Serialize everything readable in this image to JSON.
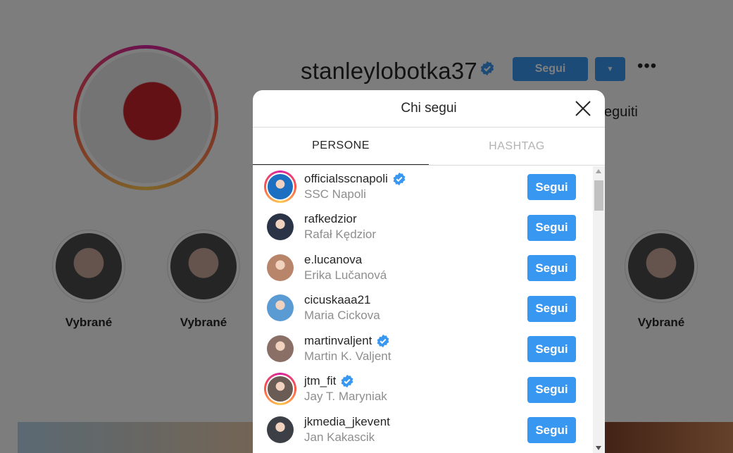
{
  "profile": {
    "username": "stanleylobotka37",
    "follow_label": "Segui",
    "more_label": "•••",
    "seguiti_label": "eguiti"
  },
  "highlights": [
    {
      "label": "Vybrané"
    },
    {
      "label": "Vybrané"
    },
    {
      "label": "Vybrané"
    }
  ],
  "modal": {
    "title": "Chi segui",
    "tabs": [
      {
        "label": "PERSONE",
        "active": true
      },
      {
        "label": "HASHTAG",
        "active": false
      }
    ],
    "follow_label": "Segui",
    "users": [
      {
        "username": "officialsscnapoli",
        "full_name": "SSC Napoli",
        "verified": true,
        "story": true,
        "avatar_color": "#1d6fc2"
      },
      {
        "username": "rafkedzior",
        "full_name": "Rafał Kędzior",
        "verified": false,
        "story": false,
        "avatar_color": "#2b3346"
      },
      {
        "username": "e.lucanova",
        "full_name": "Erika Lučanová",
        "verified": false,
        "story": false,
        "avatar_color": "#b9856a"
      },
      {
        "username": "cicuskaaa21",
        "full_name": "Maria Cickova",
        "verified": false,
        "story": false,
        "avatar_color": "#5a9bd4"
      },
      {
        "username": "martinvaljent",
        "full_name": "Martin K. Valjent",
        "verified": true,
        "story": false,
        "avatar_color": "#8a6f66"
      },
      {
        "username": "jtm_fit",
        "full_name": "Jay T. Maryniak",
        "verified": true,
        "story": true,
        "avatar_color": "#6b5b55"
      },
      {
        "username": "jkmedia_jkevent",
        "full_name": "Jan Kakascik",
        "verified": false,
        "story": false,
        "avatar_color": "#3c3f46"
      }
    ]
  },
  "colors": {
    "accent": "#3897f0",
    "verified": "#3897f0",
    "text": "#262626",
    "muted": "#8e8e8e"
  }
}
